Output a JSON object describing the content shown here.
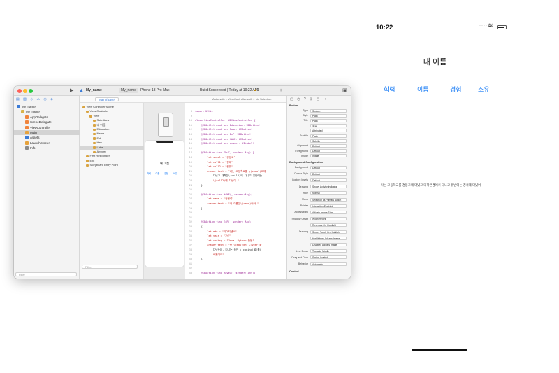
{
  "xcode": {
    "titlebar": {
      "project": "My_name",
      "scheme": "My_name",
      "device": "iPhone 13 Pro Max",
      "status": "Build Succeeded | Today at 19:22 AM",
      "warnings": "1"
    },
    "tab": "Main (Base)",
    "navigator": {
      "items": [
        {
          "label": "My_name",
          "level": 0,
          "color": "#3b7bd6"
        },
        {
          "label": "My_name",
          "level": 1,
          "color": "#d9b34a"
        },
        {
          "label": "AppDelegate",
          "level": 2,
          "color": "#f0843c"
        },
        {
          "label": "SceneDelegate",
          "level": 2,
          "color": "#f0843c"
        },
        {
          "label": "ViewController",
          "level": 2,
          "color": "#f0843c"
        },
        {
          "label": "Main",
          "level": 2,
          "color": "#e6a23c"
        },
        {
          "label": "Assets",
          "level": 2,
          "color": "#3b7bd6"
        },
        {
          "label": "LaunchScreen",
          "level": 2,
          "color": "#e6a23c"
        },
        {
          "label": "Info",
          "level": 2,
          "color": "#8a8a8a"
        }
      ],
      "selected_index": 5,
      "filter_placeholder": "Filter"
    },
    "outline": {
      "items": [
        {
          "label": "View Controller Scene",
          "level": 0
        },
        {
          "label": "View Controller",
          "level": 1
        },
        {
          "label": "View",
          "level": 2
        },
        {
          "label": "Safe Area",
          "level": 3
        },
        {
          "label": "내 이름",
          "level": 3
        },
        {
          "label": "Education",
          "level": 3
        },
        {
          "label": "Name",
          "level": 3
        },
        {
          "label": "Exf",
          "level": 3
        },
        {
          "label": "Hav",
          "level": 3
        },
        {
          "label": "Label",
          "level": 3
        },
        {
          "label": "Answer",
          "level": 3
        },
        {
          "label": "First Responder",
          "level": 1
        },
        {
          "label": "Exit",
          "level": 1
        },
        {
          "label": "Storyboard Entry Point",
          "level": 1
        }
      ],
      "selected_index": 9,
      "filter_placeholder": "Filter"
    },
    "jumpbar_text": "Automatic > ViewController.swift > No Selection",
    "canvas": {
      "title": "내 이름",
      "buttons": [
        "학력",
        "이름",
        "경험",
        "소유"
      ]
    },
    "code_lines": [
      {
        "n": "8",
        "t": "import UIKit"
      },
      {
        "n": "9",
        "t": ""
      },
      {
        "n": "10",
        "t": "class ViewController: UIViewController {"
      },
      {
        "n": "11",
        "t": "    @IBOutlet weak var Education: UIButton!"
      },
      {
        "n": "12",
        "t": "    @IBOutlet weak var Name: UIButton!"
      },
      {
        "n": "13",
        "t": "    @IBOutlet weak var ExP: UIButton!"
      },
      {
        "n": "14",
        "t": "    @IBOutlet weak var HAVE: UIButton!"
      },
      {
        "n": "15",
        "t": "    @IBOutlet weak var answer: UILabel!"
      },
      {
        "n": "16",
        "t": ""
      },
      {
        "n": "17",
        "t": "    @IBAction func EDuC_ sender: Any) {"
      },
      {
        "n": "18",
        "t": "        let shool = \"경동고\""
      },
      {
        "n": "19",
        "t": "        let coll1 = \"정대\""
      },
      {
        "n": "20",
        "t": "        let coll2 = \"컴퓨\""
      },
      {
        "n": "21",
        "t": "        answer.text = \"나는 고등학교를 \\(shool)고에"
      },
      {
        "n": "22",
        "t": "            다녔고 대학은\\(coll1)에 다니고 유반에는"
      },
      {
        "n": "23",
        "t": "            \\(coll2)에 다녔어.\""
      },
      {
        "n": "24",
        "t": "    }"
      },
      {
        "n": "25",
        "t": ""
      },
      {
        "n": "26",
        "t": "    @IBAction func NAME(_ sender:Any){"
      },
      {
        "n": "27",
        "t": "        let name = \"정윤석\""
      },
      {
        "n": "28",
        "t": "        answer.text = \"내 이름은\\(name)이야.\""
      },
      {
        "n": "29",
        "t": "    }"
      },
      {
        "n": "30",
        "t": ""
      },
      {
        "n": "31",
        "t": ""
      },
      {
        "n": "32",
        "t": "    @IBAction func ExP(_ sender: Any)"
      },
      {
        "n": "33",
        "t": "    {"
      },
      {
        "n": "34",
        "t": "        let edu = \"아이티센스\""
      },
      {
        "n": "35",
        "t": "        let year = \"3년\""
      },
      {
        "n": "36",
        "t": "        let coding = \"Java, Python 등등\""
      },
      {
        "n": "37",
        "t": "        answer.text = \"난 \\(edu)에서 \\(year)을"
      },
      {
        "n": "38",
        "t": "            다녔는데, 다니는 동안 \\(coding)을(를)"
      },
      {
        "n": "39",
        "t": "            배웠어요\""
      },
      {
        "n": "40",
        "t": "    }"
      },
      {
        "n": "41",
        "t": ""
      },
      {
        "n": "42",
        "t": ""
      },
      {
        "n": "43",
        "t": "    @IBAction func Have1(_ sender: Any){"
      }
    ],
    "inspector": {
      "section": "Button",
      "rows": [
        {
          "label": "Type",
          "value": "System"
        },
        {
          "label": "Style",
          "value": "Plain"
        },
        {
          "label": "Title",
          "value": "Plain"
        },
        {
          "label": "",
          "value": "소유"
        },
        {
          "label": "",
          "value": "Attributed"
        },
        {
          "label": "Subtitle",
          "value": "Plain"
        },
        {
          "label": "",
          "value": "Subtitle"
        },
        {
          "label": "Alignment",
          "value": "Default"
        },
        {
          "label": "Foreground",
          "value": "Default"
        },
        {
          "label": "Image",
          "value": "Image"
        }
      ],
      "bg_section": "Background Configuration",
      "bg_rows": [
        {
          "label": "Background",
          "value": "Default"
        },
        {
          "label": "Corner Style",
          "value": "Default"
        },
        {
          "label": "Content Insets",
          "value": "Default"
        },
        {
          "label": "Drawing",
          "value": "Shows Activity Indicator"
        },
        {
          "label": "Role",
          "value": "Normal"
        },
        {
          "label": "Menu",
          "value": "Selection as Primary Action"
        },
        {
          "label": "Pointer",
          "value": "Interaction Enabled"
        },
        {
          "label": "Accessibility",
          "value": "Adjusts Image Size"
        },
        {
          "label": "Shadow Offset",
          "value": "Width      Height"
        },
        {
          "label": "",
          "value": "Reverses On Highlight"
        },
        {
          "label": "Drawing",
          "value": "Shows Touch On Highlight"
        },
        {
          "label": "",
          "value": "Highlighted Adjusts Image"
        },
        {
          "label": "",
          "value": "Disabled Adjusts Image"
        },
        {
          "label": "Line Break",
          "value": "Truncate Middle"
        },
        {
          "label": "Drag and Drop",
          "value": "Spring Loaded"
        },
        {
          "label": "Behavior",
          "value": "Automatic"
        }
      ],
      "control_section": "Control",
      "alignment_label": "Alignment",
      "horizontal_label": "Horizontal",
      "vertical_label": "Vertical"
    }
  },
  "simulator": {
    "time": "10:22",
    "title": "내 이름",
    "buttons": [
      "학력",
      "이름",
      "경험",
      "소유"
    ],
    "answer": "나는 고등학교를 경동고에 다녔고 대학은경에서 다니고 유반에는 경서에 다녔어.",
    "accent": "#1a7cf5"
  }
}
